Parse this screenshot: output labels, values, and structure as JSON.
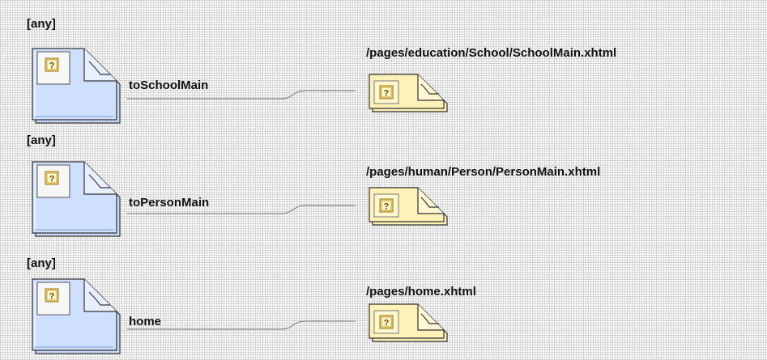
{
  "rules": [
    {
      "source_label": "[any]",
      "outcome": "toSchoolMain",
      "target_path": "/pages/education/School/SchoolMain.xhtml"
    },
    {
      "source_label": "[any]",
      "outcome": "toPersonMain",
      "target_path": "/pages/human/Person/PersonMain.xhtml"
    },
    {
      "source_label": "[any]",
      "outcome": "home",
      "target_path": "/pages/home.xhtml"
    }
  ],
  "icons": {
    "source": "source-page-icon",
    "target": "target-page-icon",
    "unknown": "question-mark-icon"
  },
  "colors": {
    "source_fill": "#cfe0ff",
    "target_fill": "#fff2b8",
    "connector": "#8a8a8a"
  }
}
